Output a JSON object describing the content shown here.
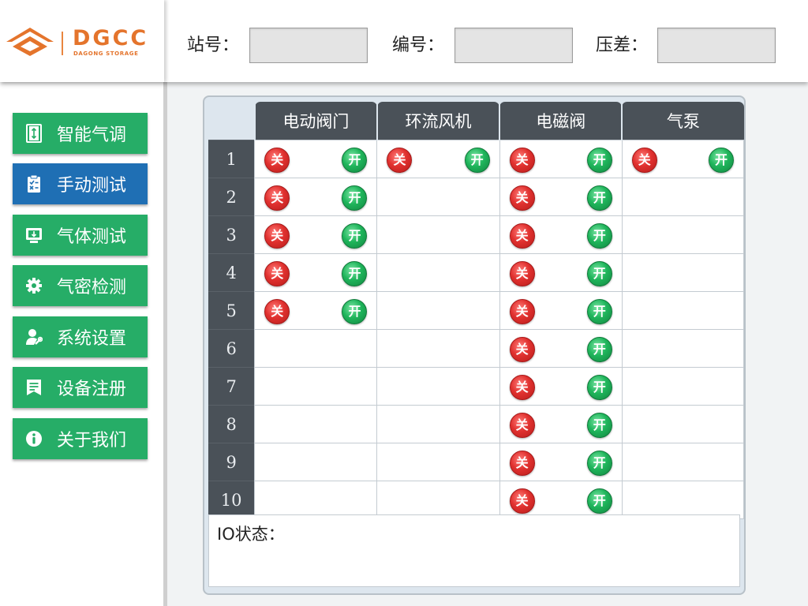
{
  "brand": {
    "name": "DGCC",
    "subtitle": "DAGONG STORAGE",
    "colors": {
      "orange": "#e4742c"
    }
  },
  "header": {
    "fields": [
      {
        "label": "站号：",
        "value": ""
      },
      {
        "label": "编号：",
        "value": ""
      },
      {
        "label": "压差：",
        "value": ""
      }
    ]
  },
  "sidebar": {
    "items": [
      {
        "label": "智能气调",
        "icon": "door-icon",
        "active": false
      },
      {
        "label": "手动测试",
        "icon": "clipboard-check-icon",
        "active": true
      },
      {
        "label": "气体测试",
        "icon": "monitor-download-icon",
        "active": false
      },
      {
        "label": "气密检测",
        "icon": "gear-icon",
        "active": false
      },
      {
        "label": "系统设置",
        "icon": "user-settings-icon",
        "active": false
      },
      {
        "label": "设备注册",
        "icon": "bookmark-list-icon",
        "active": false
      },
      {
        "label": "关于我们",
        "icon": "info-icon",
        "active": false
      }
    ],
    "colors": {
      "normal": "#26ad67",
      "active": "#1f6fb4"
    }
  },
  "grid": {
    "columns": [
      "电动阀门",
      "环流风机",
      "电磁阀",
      "气泵"
    ],
    "rows": [
      "1",
      "2",
      "3",
      "4",
      "5",
      "6",
      "7",
      "8",
      "9",
      "10"
    ],
    "off_label": "关",
    "on_label": "开",
    "controls_present": [
      [
        true,
        true,
        true,
        true
      ],
      [
        true,
        false,
        true,
        false
      ],
      [
        true,
        false,
        true,
        false
      ],
      [
        true,
        false,
        true,
        false
      ],
      [
        true,
        false,
        true,
        false
      ],
      [
        false,
        false,
        true,
        false
      ],
      [
        false,
        false,
        true,
        false
      ],
      [
        false,
        false,
        true,
        false
      ],
      [
        false,
        false,
        true,
        false
      ],
      [
        false,
        false,
        true,
        false
      ]
    ]
  },
  "status": {
    "label": "IO状态："
  }
}
